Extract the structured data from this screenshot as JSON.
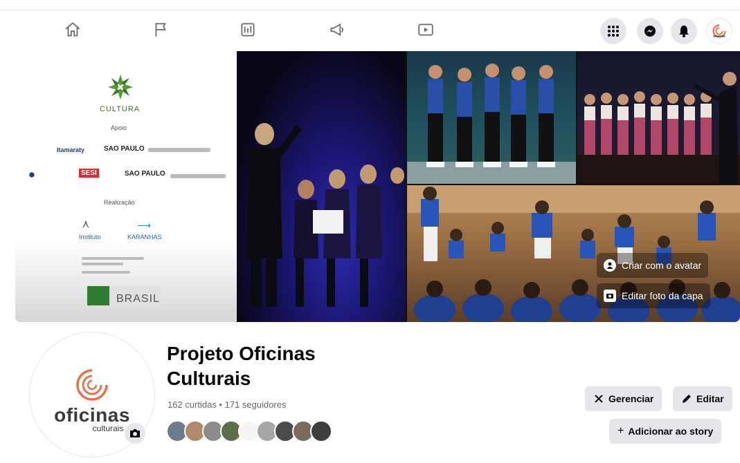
{
  "nav": {
    "icons": [
      "home-icon",
      "flag-icon",
      "news-icon",
      "megaphone-icon",
      "video-icon"
    ],
    "right_icons": [
      "menu-grid-icon",
      "messenger-icon",
      "notifications-icon"
    ]
  },
  "cover": {
    "sponsors": {
      "brand": "CULTURA",
      "apoio": "Apoio",
      "realizacao": "Realização",
      "partners": [
        "Itamaraty",
        "SAO PAULO",
        "SESI",
        "SAO PAULO"
      ],
      "realizers": [
        "Instituto",
        "KARANHAS"
      ],
      "government": "BRASIL"
    },
    "actions": {
      "avatar_label": "Criar com o avatar",
      "edit_cover_label": "Editar foto da capa"
    }
  },
  "profile": {
    "logo_word": "oficinas",
    "logo_sub": "culturais",
    "title": "Projeto Oficinas Culturais",
    "stats": "162 curtidas • 171 seguidores",
    "friend_count": 9
  },
  "buttons": {
    "manage": "Gerenciar",
    "edit": "Editar",
    "add_story": "Adicionar ao story"
  },
  "colors": {
    "accent": "#1877f2",
    "logo_orange": "#e8704a",
    "button_bg": "#e4e6eb"
  }
}
